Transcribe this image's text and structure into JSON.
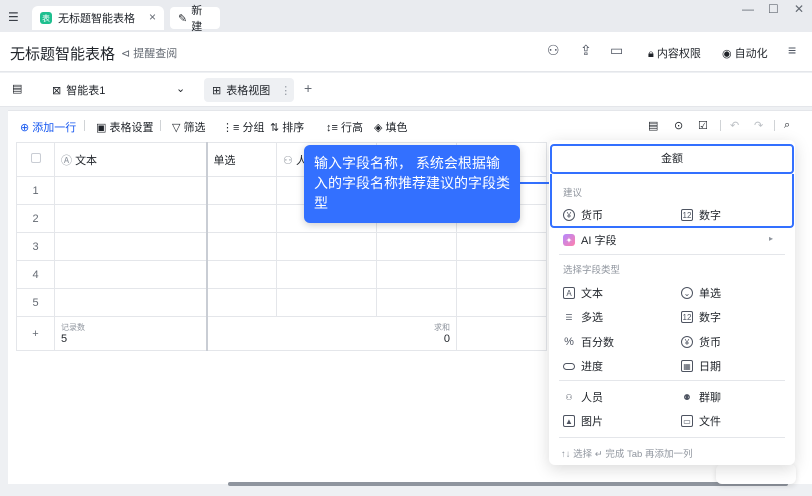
{
  "tabs": {
    "active_title": "无标题智能表格",
    "logo_text": "表",
    "new_label": "新建"
  },
  "header": {
    "doc_title": "无标题智能表格",
    "remind_label": "提醒查阅",
    "permission_label": "内容权限",
    "automation_label": "自动化"
  },
  "viewbar": {
    "sheet_name": "智能表1",
    "view_name": "表格视图",
    "add": "+"
  },
  "toolbar": {
    "add_row": "添加一行",
    "table_settings": "表格设置",
    "filter": "筛选",
    "group": "分组",
    "sort": "排序",
    "row_height": "行高",
    "fill": "填色"
  },
  "grid": {
    "columns": [
      "文本",
      "单选",
      "人"
    ],
    "rows": [
      "1",
      "2",
      "3",
      "4",
      "5"
    ],
    "add_row_symbol": "+",
    "stats": {
      "count_label": "记录数",
      "count_value": "5",
      "sum_label": "求和",
      "sum_value": "0"
    }
  },
  "tooltip": {
    "text": "输入字段名称， 系统会根据输入的字段名称推荐建议的字段类型"
  },
  "field_panel": {
    "name_value": "金额",
    "suggest_title": "建议",
    "suggest": [
      "货币",
      "数字"
    ],
    "ai_field": "AI 字段",
    "types_title": "选择字段类型",
    "types": [
      "文本",
      "单选",
      "多选",
      "数字",
      "百分数",
      "货币",
      "进度",
      "日期",
      "人员",
      "群聊",
      "图片",
      "文件"
    ],
    "footer": "↑↓ 选择   ↵ 完成   Tab 再添加一列"
  }
}
